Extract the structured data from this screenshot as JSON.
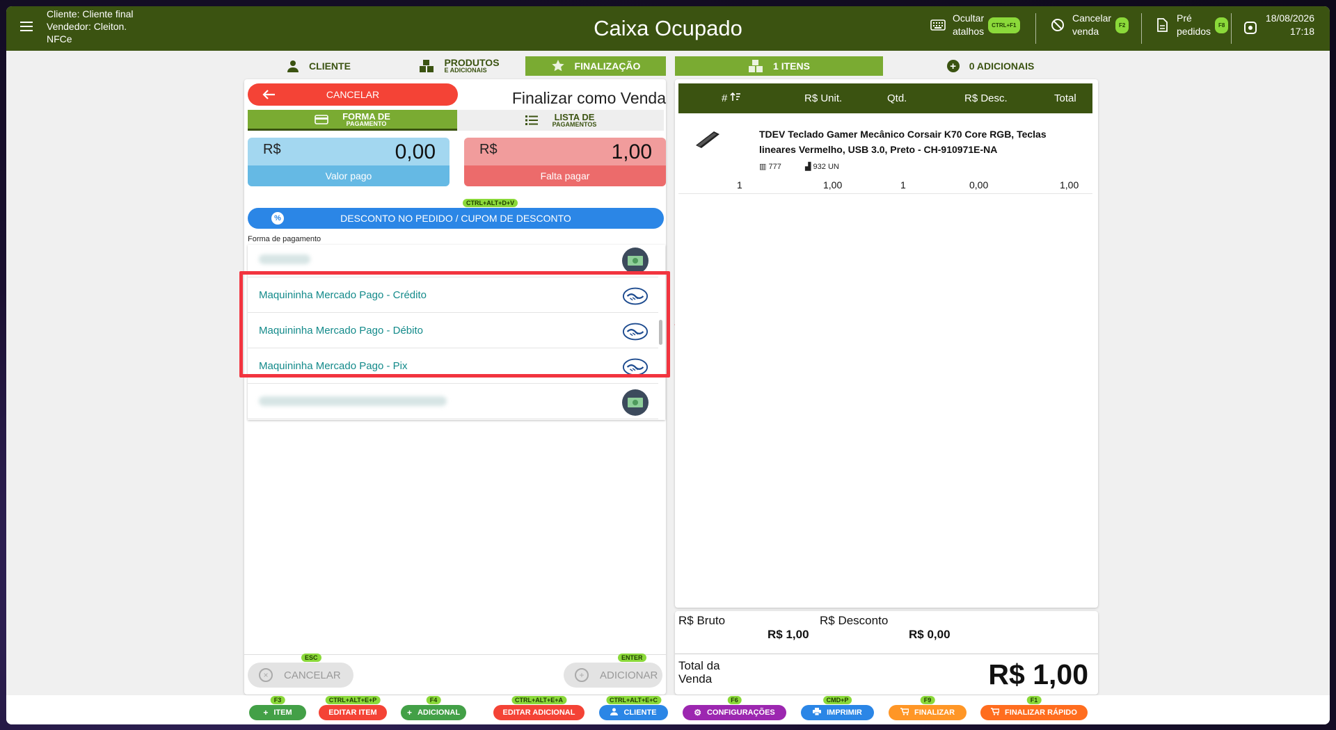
{
  "header": {
    "client": "Cliente: Cliente final",
    "seller": "Vendedor: Cleiton.",
    "doc_type": "NFCe",
    "title": "Caixa Ocupado",
    "hide_shortcuts": [
      "Ocultar",
      "atalhos"
    ],
    "hide_shortcuts_key": "CTRL+F1",
    "cancel_sale": [
      "Cancelar",
      "venda"
    ],
    "cancel_sale_key": "F2",
    "pre_orders": [
      "Pré",
      "pedidos"
    ],
    "pre_orders_key": "F8",
    "date": "18/08/2026",
    "time": "17:18"
  },
  "left_tabs": {
    "cliente": "CLIENTE",
    "produtos": "PRODUTOS",
    "produtos_sub": "E ADICIONAIS",
    "finalizacao": "FINALIZAÇÃO"
  },
  "right_tabs": {
    "itens": "1 ITENS",
    "adicionais": "0 ADICIONAIS"
  },
  "finalize": {
    "cancel_label": "CANCELAR",
    "title": "Finalizar como Venda",
    "tab_forma": "FORMA DE",
    "tab_forma_sub": "PAGAMENTO",
    "tab_lista": "LISTA DE",
    "tab_lista_sub": "PAGAMENTOS",
    "paid_currency": "R$",
    "paid_amount": "0,00",
    "paid_label": "Valor pago",
    "owe_currency": "R$",
    "owe_amount": "1,00",
    "owe_label": "Falta pagar",
    "discount_key": "CTRL+ALT+D+V",
    "discount_label": "DESCONTO NO PEDIDO / CUPOM DE DESCONTO",
    "payment_method_label": "Forma de pagamento",
    "payment_methods": [
      {
        "name": "",
        "icon": "money-icon"
      },
      {
        "name": "Maquininha Mercado Pago - Crédito",
        "icon": "mercado-pago-icon"
      },
      {
        "name": "Maquininha Mercado Pago - Débito",
        "icon": "mercado-pago-icon"
      },
      {
        "name": "Maquininha Mercado Pago - Pix",
        "icon": "mercado-pago-icon"
      },
      {
        "name": "",
        "icon": "money-icon"
      }
    ],
    "bottom_cancel": "CANCELAR",
    "bottom_cancel_key": "ESC",
    "bottom_add": "ADICIONAR",
    "bottom_add_key": "ENTER"
  },
  "items_table": {
    "columns": [
      "#",
      "R$ Unit.",
      "Qtd.",
      "R$ Desc.",
      "Total"
    ],
    "rows": [
      {
        "name": "TDEV Teclado Gamer Mecânico Corsair K70 Core RGB, Teclas lineares Vermelho, USB 3.0, Preto - CH-910971E-NA",
        "code": "777",
        "stock": "932 UN",
        "index": "1",
        "unit": "1,00",
        "qty": "1",
        "disc": "0,00",
        "total": "1,00"
      }
    ]
  },
  "totals": {
    "gross_label": "R$ Bruto",
    "gross_value": "R$ 1,00",
    "discount_label": "R$ Desconto",
    "discount_value": "R$ 0,00",
    "total_label_1": "Total da",
    "total_label_2": "Venda",
    "total_value": "R$ 1,00"
  },
  "footer": [
    {
      "label": "ITEM",
      "key": "F3",
      "color": "#43a047",
      "icon": "+"
    },
    {
      "label": "EDITAR ITEM",
      "key": "CTRL+ALT+E+P",
      "color": "#f44336",
      "icon": ""
    },
    {
      "label": "ADICIONAL",
      "key": "F4",
      "color": "#43a047",
      "icon": "+"
    },
    {
      "label": "EDITAR ADICIONAL",
      "key": "CTRL+ALT+E+A",
      "color": "#f44336",
      "icon": ""
    },
    {
      "label": "CLIENTE",
      "key": "CTRL+ALT+E+C",
      "color": "#2b86e6",
      "icon": "user"
    },
    {
      "label": "CONFIGURAÇÕES",
      "key": "F6",
      "color": "#9c27b0",
      "icon": "gear"
    },
    {
      "label": "IMPRIMIR",
      "key": "CMD+P",
      "color": "#2b86e6",
      "icon": "print"
    },
    {
      "label": "FINALIZAR",
      "key": "F9",
      "color": "#ff9626",
      "icon": "cart"
    },
    {
      "label": "FINALIZAR RÁPIDO",
      "key": "F1",
      "color": "#ff6d1f",
      "icon": "cart"
    }
  ]
}
